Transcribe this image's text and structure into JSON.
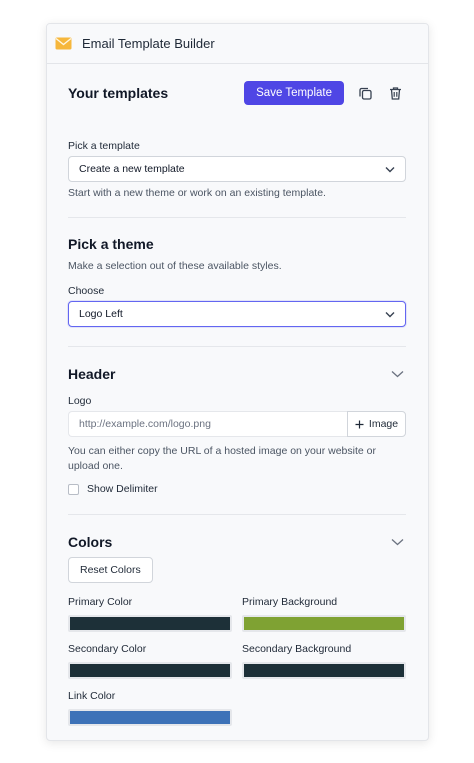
{
  "window": {
    "title": "Email Template Builder",
    "icon": "mail-icon"
  },
  "templates": {
    "heading": "Your templates",
    "save_label": "Save Template",
    "copy_icon": "copy-icon",
    "delete_icon": "trash-icon",
    "pick_label": "Pick a template",
    "selected": "Create a new template",
    "help": "Start with a new theme or work on an existing template."
  },
  "theme": {
    "heading": "Pick a theme",
    "help": "Make a selection out of these available styles.",
    "choose_label": "Choose",
    "selected": "Logo Left"
  },
  "header": {
    "heading": "Header",
    "logo_label": "Logo",
    "logo_placeholder": "http://example.com/logo.png",
    "image_button": "Image",
    "help_line1": "You can either copy the URL of a hosted image on your website or",
    "help_line2": "upload one.",
    "delimiter_label": "Show Delimiter",
    "delimiter_checked": false
  },
  "colors": {
    "heading": "Colors",
    "reset_label": "Reset Colors",
    "primary_color": {
      "label": "Primary Color",
      "value": "#1d3038"
    },
    "primary_background": {
      "label": "Primary Background",
      "value": "#7fa233"
    },
    "secondary_color": {
      "label": "Secondary Color",
      "value": "#1d3038"
    },
    "secondary_background": {
      "label": "Secondary Background",
      "value": "#1d3038"
    },
    "link_color": {
      "label": "Link Color",
      "value": "#3d72b8"
    }
  },
  "accent": "#4f46e5"
}
